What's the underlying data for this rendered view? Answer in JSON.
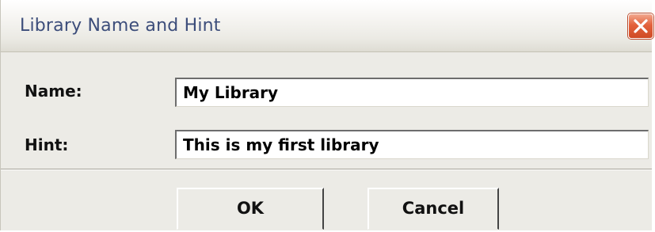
{
  "window": {
    "title": "Library Name and Hint",
    "close_icon": "close-icon"
  },
  "form": {
    "name_label": "Name:",
    "name_value": "My Library",
    "hint_label": "Hint:",
    "hint_value": "This is my first library"
  },
  "buttons": {
    "ok_label": "OK",
    "cancel_label": "Cancel"
  },
  "colors": {
    "title_text": "#3c4d7a",
    "close_button": "#e3623c",
    "dialog_background": "#ecebe6"
  }
}
